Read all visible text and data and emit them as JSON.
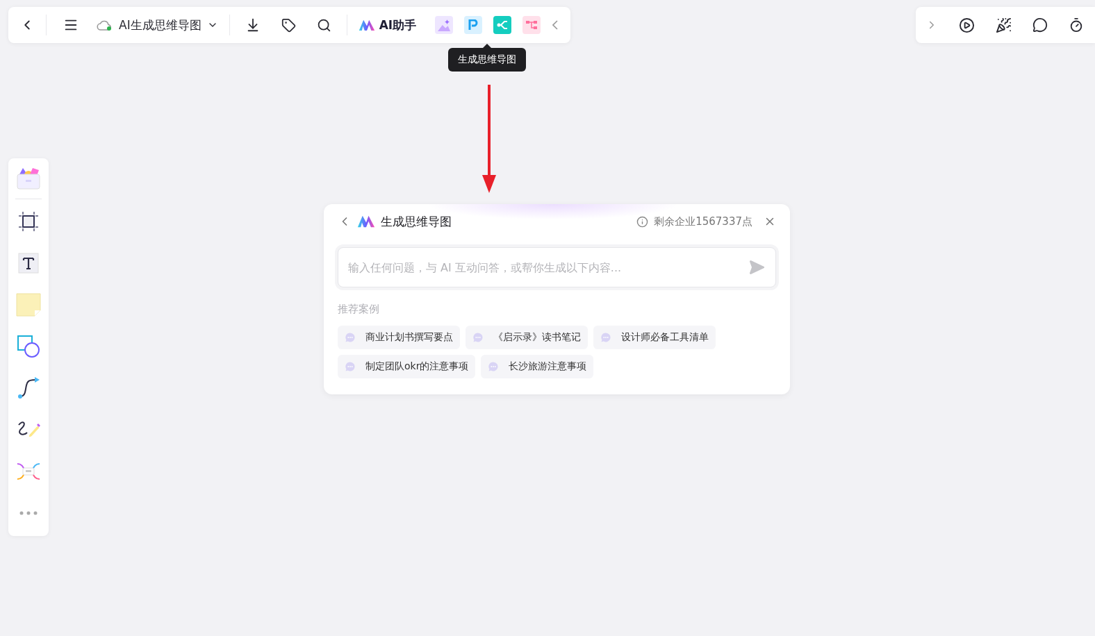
{
  "toolbar": {
    "doc_title": "AI生成思维导图",
    "ai_button": "AI助手",
    "tooltip": "生成思维导图"
  },
  "dialog": {
    "title": "生成思维导图",
    "quota": "剩余企业1567337点",
    "input": {
      "placeholder": "输入任何问题，与 AI 互动问答，或帮你生成以下内容..."
    },
    "section_label": "推荐案例",
    "examples": [
      "商业计划书撰写要点",
      "《启示录》读书笔记",
      "设计师必备工具清单",
      "制定团队okr的注意事项",
      "长沙旅游注意事项"
    ]
  }
}
